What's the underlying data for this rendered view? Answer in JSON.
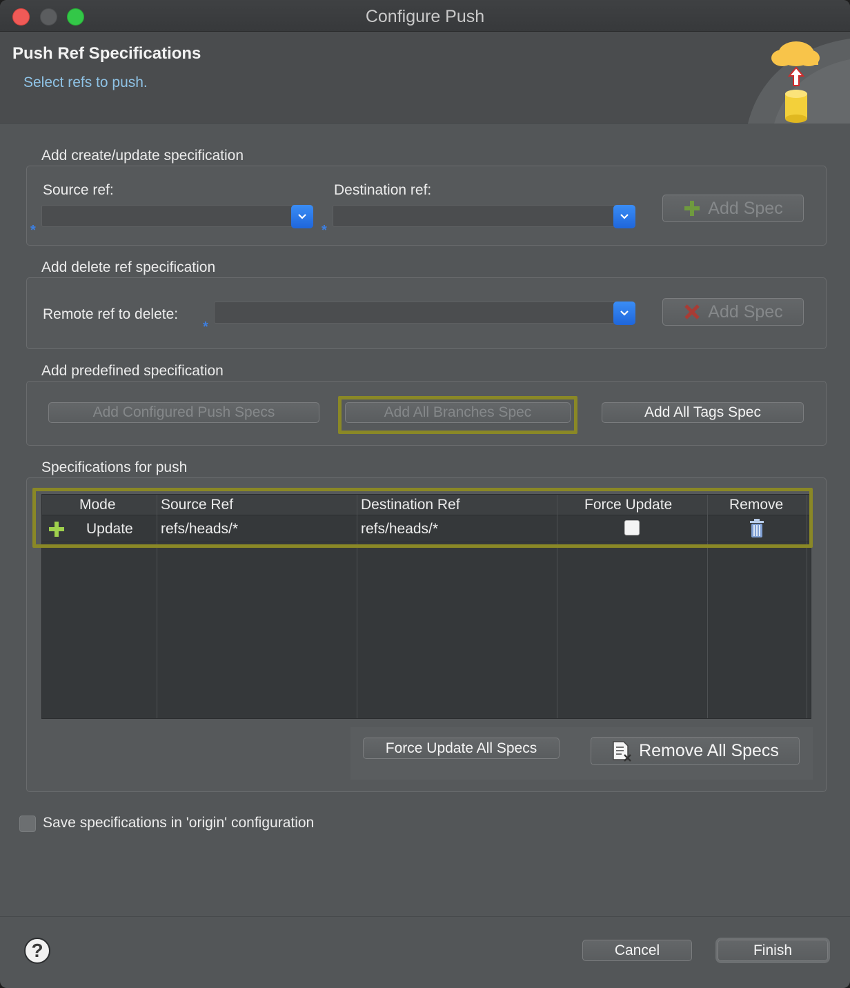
{
  "window": {
    "title": "Configure Push"
  },
  "header": {
    "title": "Push Ref Specifications",
    "subtitle": "Select refs to push."
  },
  "create_update": {
    "group_label": "Add create/update specification",
    "source_label": "Source ref:",
    "destination_label": "Destination ref:",
    "required_marker": "*",
    "add_spec_label": "Add Spec"
  },
  "delete_ref": {
    "group_label": "Add delete ref specification",
    "remote_label": "Remote ref to delete:",
    "required_marker": "*",
    "add_spec_label": "Add Spec"
  },
  "predefined": {
    "group_label": "Add predefined specification",
    "configured_label": "Add Configured Push Specs",
    "all_branches_label": "Add All Branches Spec",
    "all_tags_label": "Add All Tags Spec"
  },
  "specs": {
    "group_label": "Specifications for push",
    "columns": [
      "Mode",
      "Source Ref",
      "Destination Ref",
      "Force Update",
      "Remove"
    ],
    "rows": [
      {
        "mode": "Update",
        "source": "refs/heads/*",
        "destination": "refs/heads/*",
        "force_update": false
      }
    ],
    "force_update_all_label": "Force Update All Specs",
    "remove_all_label": "Remove All Specs"
  },
  "save": {
    "label": "Save specifications in 'origin' configuration",
    "checked": false
  },
  "footer": {
    "help_label": "?",
    "cancel_label": "Cancel",
    "finish_label": "Finish"
  },
  "colors": {
    "accent": "#1f66db",
    "highlight": "#8a8826",
    "link_text": "#8fc3e6"
  }
}
